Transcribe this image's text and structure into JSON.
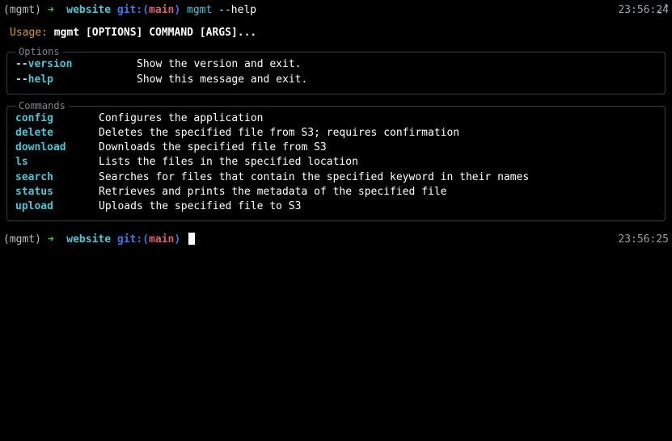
{
  "prompt1": {
    "env": "(mgmt) ",
    "arrow": "➜  ",
    "dir": "website ",
    "git_label": "git:",
    "paren_open": "(",
    "branch": "main",
    "paren_close": ") ",
    "cmd": "mgmt ",
    "arg": "--help",
    "timestamp": "23:56:24"
  },
  "usage": {
    "label": "Usage: ",
    "text": "mgmt [OPTIONS] COMMAND [ARGS]..."
  },
  "options_box": {
    "title": "Options",
    "items": [
      {
        "dashes": "--",
        "name": "version",
        "desc": "Show the version and exit."
      },
      {
        "dashes": "--",
        "name": "help",
        "desc": "Show this message and exit."
      }
    ]
  },
  "commands_box": {
    "title": "Commands",
    "items": [
      {
        "name": "config",
        "desc": "Configures the application"
      },
      {
        "name": "delete",
        "desc": "Deletes the specified file from S3; requires confirmation"
      },
      {
        "name": "download",
        "desc": "Downloads the specified file from S3"
      },
      {
        "name": "ls",
        "desc": "Lists the files in the specified location"
      },
      {
        "name": "search",
        "desc": "Searches for files that contain the specified keyword in their names"
      },
      {
        "name": "status",
        "desc": "Retrieves and prints the metadata of the specified file"
      },
      {
        "name": "upload",
        "desc": "Uploads the specified file to S3"
      }
    ]
  },
  "prompt2": {
    "env": "(mgmt) ",
    "arrow": "➜  ",
    "dir": "website ",
    "git_label": "git:",
    "paren_open": "(",
    "branch": "main",
    "paren_close": ") ",
    "timestamp": "23:56:25"
  }
}
